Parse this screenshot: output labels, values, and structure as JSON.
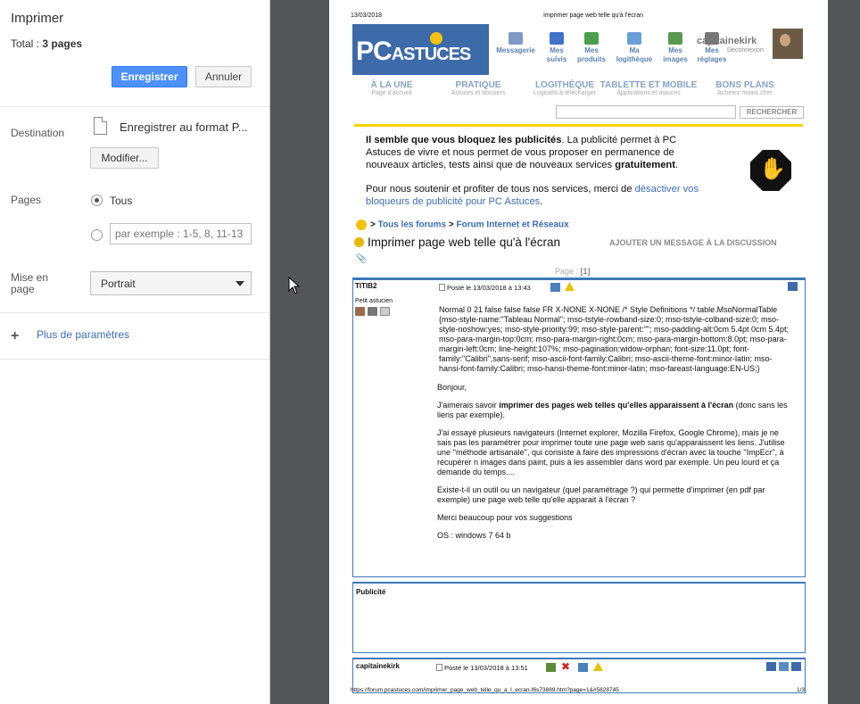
{
  "panel": {
    "title": "Imprimer",
    "total_label": "Total : ",
    "total_value": "3 pages",
    "save_label": "Enregistrer",
    "cancel_label": "Annuler",
    "destination_label": "Destination",
    "destination_value": "Enregistrer au format P...",
    "modify_label": "Modifier...",
    "pages_label": "Pages",
    "pages_all": "Tous",
    "pages_placeholder": "par exemple : 1-5, 8, 11-13",
    "layout_label": "Mise en page",
    "layout_value": "Portrait",
    "more_label": "Plus de paramètres"
  },
  "preview": {
    "date": "13/03/2018",
    "title": "Imprimer page web telle qu'à l'écran",
    "logo_main": "PC",
    "logo_sub": "ASTUCES",
    "nav": [
      {
        "l1": "Messagerie",
        "l2": "",
        "color": "#7f9bc5"
      },
      {
        "l1": "Mes",
        "l2": "suivis",
        "color": "#3f73c9"
      },
      {
        "l1": "Mes",
        "l2": "produits",
        "color": "#4aa04a"
      },
      {
        "l1": "Ma",
        "l2": "logithèque",
        "color": "#6aa0d8"
      },
      {
        "l1": "Mes",
        "l2": "images",
        "color": "#5a9a4e"
      },
      {
        "l1": "Mes",
        "l2": "réglages",
        "color": "#777"
      }
    ],
    "username": "capitainekirk",
    "logout": "Déconnexion",
    "menu": [
      {
        "title": "À LA UNE",
        "sub": "Page d'accueil"
      },
      {
        "title": "PRATIQUE",
        "sub": "Astuces et dossiers"
      },
      {
        "title": "LOGITHÈQUE",
        "sub": "Logiciels à télécharger"
      },
      {
        "title": "TABLETTE ET MOBILE",
        "sub": "Applications et astuces"
      },
      {
        "title": "BONS PLANS",
        "sub": "Achetez moins cher"
      }
    ],
    "search_btn": "RECHERCHER",
    "ad_p1_bold": "Il semble que vous bloquez les publicités",
    "ad_p1_rest": ". La publicité permet à PC Astuces de vivre et nous permet de vous proposer en permanence de nouveaux articles, tests ainsi que de nouveaux services ",
    "ad_p1_bold2": "gratuitement",
    "ad_p1_end": ".",
    "ad_p2": "Pour nous soutenir et profiter de tous nos services, merci de ",
    "ad_p2_link": "désactiver vos bloqueurs de publicité pour PC Astuces",
    "ad_p2_end": ".",
    "crumb_sep": ">",
    "crumb1": "Tous les forums",
    "crumb2": "Forum Internet et Réseaux",
    "thread_title": "Imprimer page web telle qu'à l'écran",
    "add_message": "AJOUTER UN MESSAGE À LA DISCUSSION",
    "pages_prefix": "Page : ",
    "pages_current": "[1]",
    "post": {
      "author": "TITIB2",
      "rank": "Petit astucien",
      "meta": "Posté le 13/03/2018 à 13:43",
      "style_dump": "Normal 0 21 false false false FR X-NONE X-NONE /* Style Definitions */ table.MsoNormalTable {mso-style-name:\"Tableau Normal\"; mso-tstyle-rowband-size:0; mso-tstyle-colband-size:0; mso-style-noshow:yes; mso-style-priority:99; mso-style-parent:\"\"; mso-padding-alt:0cm 5.4pt 0cm 5.4pt; mso-para-margin-top:0cm; mso-para-margin-right:0cm; mso-para-margin-bottom:8.0pt; mso-para-margin-left:0cm; line-height:107%; mso-pagination:widow-orphan; font-size:11.0pt; font-family:\"Calibri\",sans-serif; mso-ascii-font-family:Calibri; mso-ascii-theme-font:minor-latin; mso-hansi-font-family:Calibri; mso-hansi-theme-font:minor-latin; mso-fareast-language:EN-US;}",
      "p1": "Bonjour,",
      "p2_pre": "J'aimerais savoir ",
      "p2_bold": "imprimer des pages web telles qu'elles apparaissent à l'écran",
      "p2_post": " (donc sans les liens par exemple).",
      "p3": "J'ai essayé plusieurs navigateurs (Internet explorer, Mozilla Firefox, Google Chrome), mais je ne sais pas les paramétrer pour imprimer toute une page web sans qu'apparaissent les liens. J'utilise une ''méthode artisanale'', qui consiste à faire des impressions d'écran avec la touche ''ImpEcr'', à récupérer n images dans paint, puis à les assembler dans word par exemple. Un peu lourd et ça demande du temps....",
      "p4": "Existe-t-il un outil ou un navigateur (quel paramétrage ?) qui permette d'imprimer (en pdf par exemple) une page web telle qu'elle apparait à l'écran ?",
      "p5": "Merci beaucoup pour vos suggestions",
      "p6": "OS : windows 7 64 b"
    },
    "pub_label": "Publicité",
    "post2_author": "capitainekirk",
    "post2_meta": "Posté le 13/03/2018 à 13:51",
    "footer_url": "https://forum.pcastuces.com/imprimer_page_web_telle_qu_a_l_ecran-f6s73889.htm?page=1&#5828745",
    "footer_page": "1/3"
  }
}
